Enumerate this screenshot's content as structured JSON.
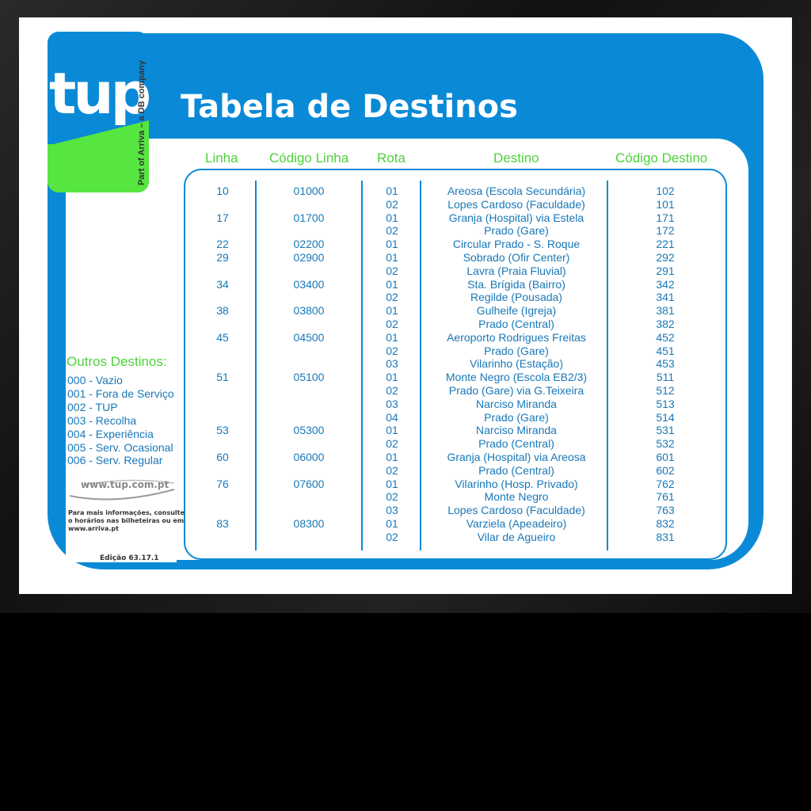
{
  "logo": {
    "text": "tup",
    "tagline": "Part of Arriva – a DB company"
  },
  "title": "Tabela de Destinos",
  "columns": {
    "linha": "Linha",
    "codigo_linha": "Código Linha",
    "rota": "Rota",
    "destino": "Destino",
    "codigo_destino": "Código Destino"
  },
  "lines": [
    {
      "linha": "10",
      "codigo": "01000"
    },
    {
      "linha": "17",
      "codigo": "01700"
    },
    {
      "linha": "22",
      "codigo": "02200"
    },
    {
      "linha": "29",
      "codigo": "02900"
    },
    {
      "linha": "34",
      "codigo": "03400"
    },
    {
      "linha": "38",
      "codigo": "03800"
    },
    {
      "linha": "45",
      "codigo": "04500"
    },
    {
      "linha": "51",
      "codigo": "05100"
    },
    {
      "linha": "53",
      "codigo": "05300"
    },
    {
      "linha": "60",
      "codigo": "06000"
    },
    {
      "linha": "76",
      "codigo": "07600"
    },
    {
      "linha": "83",
      "codigo": "08300"
    }
  ],
  "routes": [
    {
      "rota": "01",
      "destino": "Areosa (Escola Secundária)",
      "codigo": "102"
    },
    {
      "rota": "02",
      "destino": "Lopes Cardoso (Faculdade)",
      "codigo": "101"
    },
    {
      "rota": "01",
      "destino": "Granja (Hospital) via Estela",
      "codigo": "171"
    },
    {
      "rota": "02",
      "destino": "Prado (Gare)",
      "codigo": "172"
    },
    {
      "rota": "01",
      "destino": "Circular Prado - S. Roque",
      "codigo": "221"
    },
    {
      "rota": "01",
      "destino": "Sobrado (Ofir Center)",
      "codigo": "292"
    },
    {
      "rota": "02",
      "destino": "Lavra (Praia Fluvial)",
      "codigo": "291"
    },
    {
      "rota": "01",
      "destino": "Sta. Brígida (Bairro)",
      "codigo": "342"
    },
    {
      "rota": "02",
      "destino": "Regilde (Pousada)",
      "codigo": "341"
    },
    {
      "rota": "01",
      "destino": "Gulheife (Igreja)",
      "codigo": "381"
    },
    {
      "rota": "02",
      "destino": "Prado (Central)",
      "codigo": "382"
    },
    {
      "rota": "01",
      "destino": "Aeroporto Rodrigues Freitas",
      "codigo": "452"
    },
    {
      "rota": "02",
      "destino": "Prado (Gare)",
      "codigo": "451"
    },
    {
      "rota": "03",
      "destino": "Vilarinho (Estação)",
      "codigo": "453"
    },
    {
      "rota": "01",
      "destino": "Monte Negro (Escola EB2/3)",
      "codigo": "511"
    },
    {
      "rota": "02",
      "destino": "Prado (Gare) via G.Teixeira",
      "codigo": "512"
    },
    {
      "rota": "03",
      "destino": "Narciso Miranda",
      "codigo": "513"
    },
    {
      "rota": "04",
      "destino": "Prado (Gare)",
      "codigo": "514"
    },
    {
      "rota": "01",
      "destino": "Narciso Miranda",
      "codigo": "531"
    },
    {
      "rota": "02",
      "destino": "Prado (Central)",
      "codigo": "532"
    },
    {
      "rota": "01",
      "destino": "Granja (Hospital) via Areosa",
      "codigo": "601"
    },
    {
      "rota": "02",
      "destino": "Prado (Central)",
      "codigo": "602"
    },
    {
      "rota": "01",
      "destino": "Vilarinho (Hosp. Privado)",
      "codigo": "762"
    },
    {
      "rota": "02",
      "destino": "Monte Negro",
      "codigo": "761"
    },
    {
      "rota": "03",
      "destino": "Lopes Cardoso (Faculdade)",
      "codigo": "763"
    },
    {
      "rota": "01",
      "destino": "Varziela (Apeadeiro)",
      "codigo": "832"
    },
    {
      "rota": "02",
      "destino": "Vilar de Agueiro",
      "codigo": "831"
    }
  ],
  "outros": {
    "title": "Outros Destinos:",
    "items": [
      "000 - Vazio",
      "001 - Fora de Serviço",
      "002 - TUP",
      "003 - Recolha",
      "004 - Experiência",
      "005 - Serv. Ocasional",
      "006 - Serv. Regular"
    ]
  },
  "footer": {
    "website": "www.tup.com.pt",
    "info": "Para mais informações, consulte o horários nas bilheteiras ou em www.arriva.pt",
    "edition": "Edição 63.17.1"
  },
  "colors": {
    "blue": "#0a8ad6",
    "green": "#56e63f",
    "text_blue": "#1878b8"
  }
}
